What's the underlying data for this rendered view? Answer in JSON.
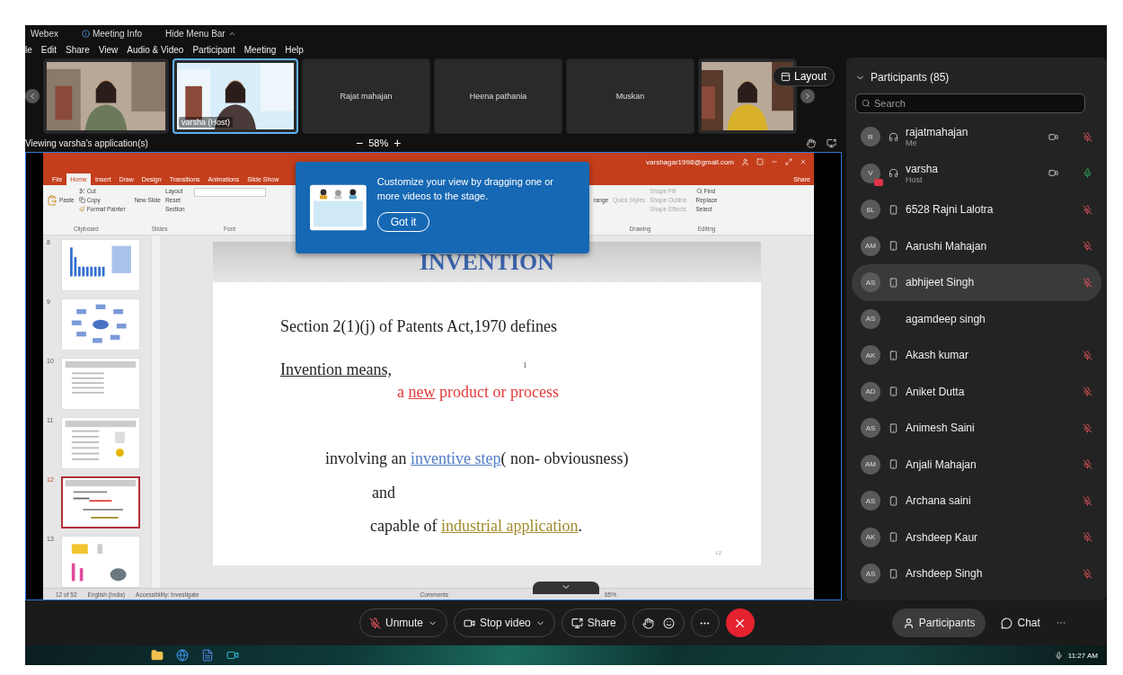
{
  "top_bar": {
    "items": [
      "Webex",
      "Meeting Info",
      "Hide Menu Bar"
    ]
  },
  "menu": [
    "le",
    "Edit",
    "Share",
    "View",
    "Audio & Video",
    "Participant",
    "Meeting",
    "Help"
  ],
  "video_strip": {
    "tiles": [
      {
        "kind": "video",
        "highlighted": false
      },
      {
        "kind": "video",
        "label": "varsha (Host)",
        "highlighted": true
      },
      {
        "kind": "name",
        "label": "Rajat mahajan",
        "highlighted": false
      },
      {
        "kind": "name",
        "label": "Heena pathania",
        "highlighted": false
      },
      {
        "kind": "name",
        "label": "Muskan",
        "highlighted": false
      },
      {
        "kind": "video",
        "highlighted": false
      }
    ],
    "layout_button": "Layout"
  },
  "viewing": {
    "text": "Viewing varsha's application(s)",
    "zoom_out": "−",
    "zoom": "58%",
    "zoom_in": "+"
  },
  "presentation": {
    "account": "varshagar1998@gmail.com",
    "tabs": [
      {
        "label": "File",
        "selected": false
      },
      {
        "label": "Home",
        "selected": true
      },
      {
        "label": "Insert",
        "selected": false
      },
      {
        "label": "Draw",
        "selected": false
      },
      {
        "label": "Design",
        "selected": false
      },
      {
        "label": "Transitions",
        "selected": false
      },
      {
        "label": "Animations",
        "selected": false
      },
      {
        "label": "Slide Show",
        "selected": false
      }
    ],
    "share_label": "Share",
    "ribbon": {
      "paste": "Paste",
      "cut": "Cut",
      "copy": "Copy",
      "format_painter": "Format Painter",
      "clipboard": "Clipboard",
      "new_slide": "New Slide",
      "layout": "Layout",
      "reset": "Reset",
      "section": "Section",
      "slides": "Slides",
      "font": "Font",
      "arrange": "range",
      "quick_styles": "Quick Styles",
      "shape_fill": "Shape Fill",
      "shape_outline": "Shape Outline",
      "shape_effects": "Shape Effects",
      "drawing": "Drawing",
      "find": "Find",
      "replace": "Replace",
      "select": "Select",
      "editing": "Editing"
    },
    "thumbnails": [
      {
        "number": "8",
        "kind": "chart",
        "selected": false
      },
      {
        "number": "9",
        "kind": "diagram",
        "selected": false
      },
      {
        "number": "10",
        "kind": "bullets",
        "selected": false
      },
      {
        "number": "11",
        "kind": "bullets-image",
        "selected": false
      },
      {
        "number": "12",
        "kind": "text",
        "selected": true
      },
      {
        "number": "13",
        "kind": "images",
        "selected": false
      }
    ],
    "slide": {
      "title": "INVENTION",
      "marker": "1",
      "page_number": "12",
      "lines": [
        [
          {
            "text": "Section 2(1)(j) of Patents Act,1970 defines",
            "kind": "plain"
          }
        ],
        [
          {
            "text": "Invention means,",
            "kind": "underline"
          }
        ],
        [
          {
            "text": "a ",
            "kind": "red"
          },
          {
            "text": "new",
            "kind": "redlink"
          },
          {
            "text": " product or process",
            "kind": "red"
          }
        ],
        [
          {
            "text": "involving an ",
            "kind": "plain"
          },
          {
            "text": "inventive step",
            "kind": "link"
          },
          {
            "text": "( non- obviousness)",
            "kind": "plain"
          }
        ],
        [
          {
            "text": "and",
            "kind": "plain"
          }
        ],
        [
          {
            "text": "capable of ",
            "kind": "plain"
          },
          {
            "text": "industrial application",
            "kind": "goldlink"
          },
          {
            "text": ".",
            "kind": "plain"
          }
        ]
      ]
    },
    "status": {
      "slide_count": "12 of 52",
      "language": "English (India)",
      "accessibility": "Accessibility: Investigate",
      "comments": "Comments",
      "zoom": "65%"
    }
  },
  "tooltip": {
    "text": "Customize your view by dragging one or more videos to the stage.",
    "button": "Got it"
  },
  "participants": {
    "title": "Participants (85)",
    "search_placeholder": "Search",
    "rows": [
      {
        "initials": "R",
        "name": "rajatmahajan",
        "role": "Me",
        "kind": "headset",
        "video": true,
        "muted": true,
        "sharing": false,
        "selected": false
      },
      {
        "initials": "V",
        "name": "varsha",
        "role": "Host",
        "kind": "headset",
        "video": true,
        "muted": false,
        "sharing": true,
        "selected": false
      },
      {
        "initials": "6L",
        "name": "6528 Rajni Lalotra",
        "kind": "phone",
        "video": false,
        "muted": true,
        "sharing": false,
        "selected": false
      },
      {
        "initials": "AM",
        "name": "Aarushi Mahajan",
        "kind": "phone",
        "video": false,
        "muted": true,
        "sharing": false,
        "selected": false
      },
      {
        "initials": "AS",
        "name": "abhijeet Singh",
        "kind": "phone",
        "video": false,
        "muted": true,
        "sharing": false,
        "selected": true
      },
      {
        "initials": "AS",
        "name": "agamdeep singh",
        "kind": "none",
        "video": false,
        "sharing": false,
        "selected": false
      },
      {
        "initials": "AK",
        "name": "Akash kumar",
        "kind": "phone",
        "video": false,
        "muted": true,
        "sharing": false,
        "selected": false
      },
      {
        "initials": "AD",
        "name": "Aniket Dutta",
        "kind": "phone",
        "video": false,
        "muted": true,
        "sharing": false,
        "selected": false
      },
      {
        "initials": "AS",
        "name": "Animesh Saini",
        "kind": "phone",
        "video": false,
        "muted": true,
        "sharing": false,
        "selected": false
      },
      {
        "initials": "AM",
        "name": "Anjali Mahajan",
        "kind": "phone",
        "video": false,
        "muted": true,
        "sharing": false,
        "selected": false
      },
      {
        "initials": "AS",
        "name": "Archana saini",
        "kind": "phone",
        "video": false,
        "muted": true,
        "sharing": false,
        "selected": false
      },
      {
        "initials": "AK",
        "name": "Arshdeep Kaur",
        "kind": "phone",
        "video": false,
        "muted": true,
        "sharing": false,
        "selected": false
      },
      {
        "initials": "AS",
        "name": "Arshdeep Singh",
        "kind": "phone",
        "video": false,
        "muted": true,
        "sharing": false,
        "selected": false
      }
    ]
  },
  "controls": {
    "unmute": "Unmute",
    "stop_video": "Stop video",
    "share": "Share",
    "participants": "Participants",
    "chat": "Chat"
  },
  "taskbar": {
    "time": "11:27 AM"
  }
}
